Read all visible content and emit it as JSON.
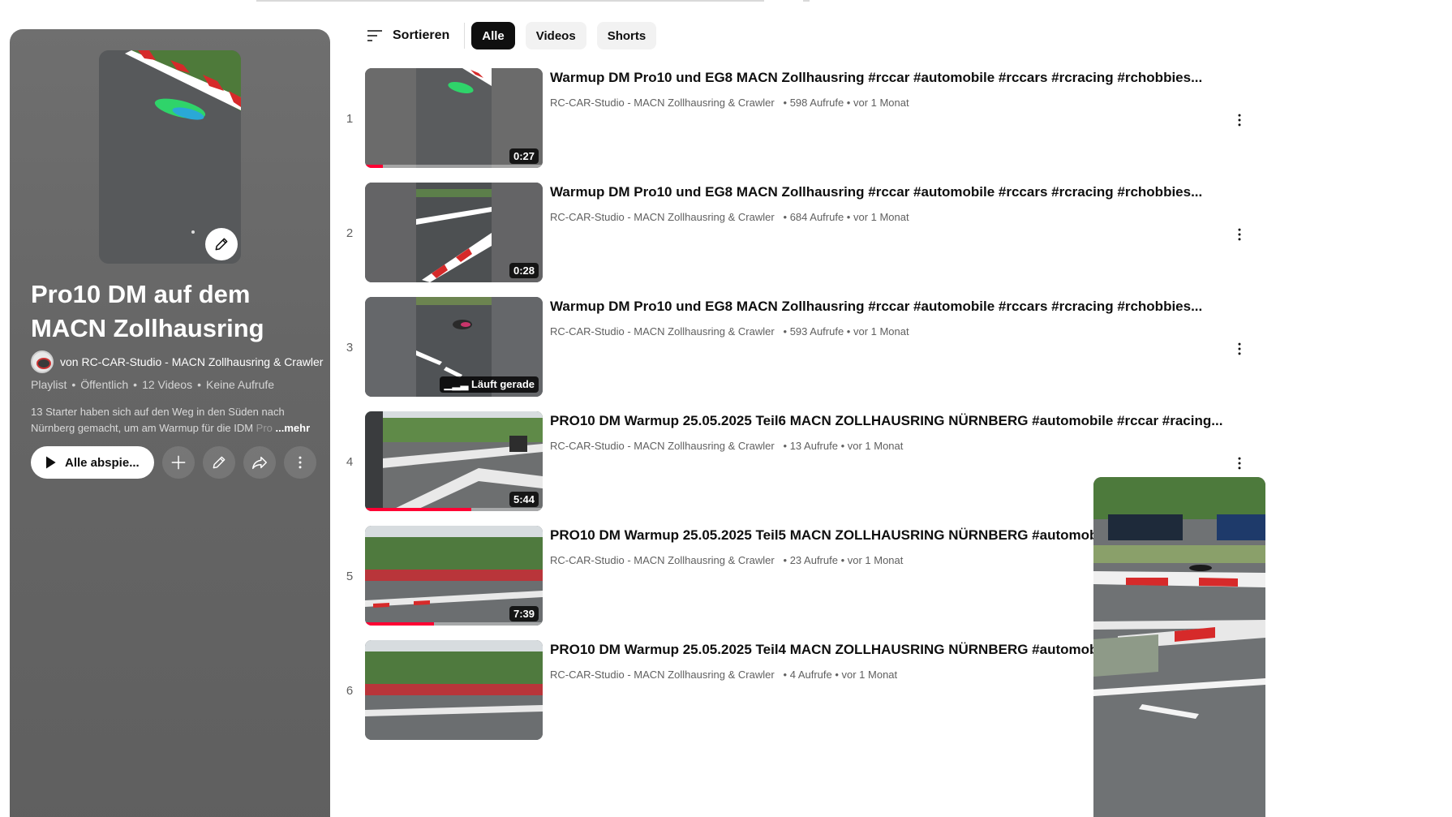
{
  "playlist": {
    "title": "Pro10 DM auf dem MACN Zollhausring",
    "owner": "von RC-CAR-Studio - MACN Zollhausring & Crawler",
    "meta": [
      "Playlist",
      "Öffentlich",
      "12 Videos",
      "Keine Aufrufe"
    ],
    "meta_sep": "•",
    "description": "13 Starter haben sich auf den Weg in den Süden nach Nürnberg gemacht, um am Warmup für die IDM ",
    "description_fade": "Pro",
    "description_more": "...mehr",
    "play_all_label": "Alle abspie..."
  },
  "chips": {
    "sort_label": "Sortieren",
    "items": [
      {
        "label": "Alle",
        "active": true
      },
      {
        "label": "Videos",
        "active": false
      },
      {
        "label": "Shorts",
        "active": false
      }
    ]
  },
  "videos": [
    {
      "index": "1",
      "title": "Warmup DM Pro10 und EG8 MACN Zollhausring #rccar #automobile #rccars #rcracing #rchobbies...",
      "channel": "RC-CAR-Studio - MACN Zollhausring & Crawler",
      "stats": "• 598 Aufrufe • vor 1 Monat",
      "duration": "0:27",
      "progress": 0.1
    },
    {
      "index": "2",
      "title": "Warmup DM Pro10 und EG8 MACN Zollhausring #rccar #automobile #rccars #rcracing #rchobbies...",
      "channel": "RC-CAR-Studio - MACN Zollhausring & Crawler",
      "stats": "• 684 Aufrufe • vor 1 Monat",
      "duration": "0:28",
      "progress": 0
    },
    {
      "index": "3",
      "title": "Warmup DM Pro10 und EG8 MACN Zollhausring #rccar #automobile #rccars #rcracing #rchobbies...",
      "channel": "RC-CAR-Studio - MACN Zollhausring & Crawler",
      "stats": "• 593 Aufrufe • vor 1 Monat",
      "duration": "Läuft gerade",
      "progress": 0
    },
    {
      "index": "4",
      "title": "PRO10 DM Warmup 25.05.2025 Teil6 MACN ZOLLHAUSRING NÜRNBERG #automobile #rccar #racing...",
      "channel": "RC-CAR-Studio - MACN Zollhausring & Crawler",
      "stats": "• 13 Aufrufe • vor 1 Monat",
      "duration": "5:44",
      "progress": 0.6
    },
    {
      "index": "5",
      "title": "PRO10 DM Warmup 25.05.2025 Teil5 MACN ZOLLHAUSRING NÜRNBERG #automobile",
      "channel": "RC-CAR-Studio - MACN Zollhausring & Crawler",
      "stats": "• 23 Aufrufe • vor 1 Monat",
      "duration": "7:39",
      "progress": 0.39
    },
    {
      "index": "6",
      "title": "PRO10 DM Warmup 25.05.2025 Teil4 MACN ZOLLHAUSRING NÜRNBERG #automobile",
      "channel": "RC-CAR-Studio - MACN Zollhausring & Crawler",
      "stats": "• 4 Aufrufe • vor 1 Monat",
      "duration": "",
      "progress": 0
    }
  ],
  "icons": {
    "sort": "sort-icon",
    "play": "play-icon",
    "add": "plus-icon",
    "edit": "pencil-icon",
    "share": "share-icon",
    "more": "more-vertical-icon"
  },
  "colors": {
    "accent": "#ff0033",
    "chip_active_bg": "#0f0f0f",
    "chip_bg": "#f2f2f2"
  }
}
